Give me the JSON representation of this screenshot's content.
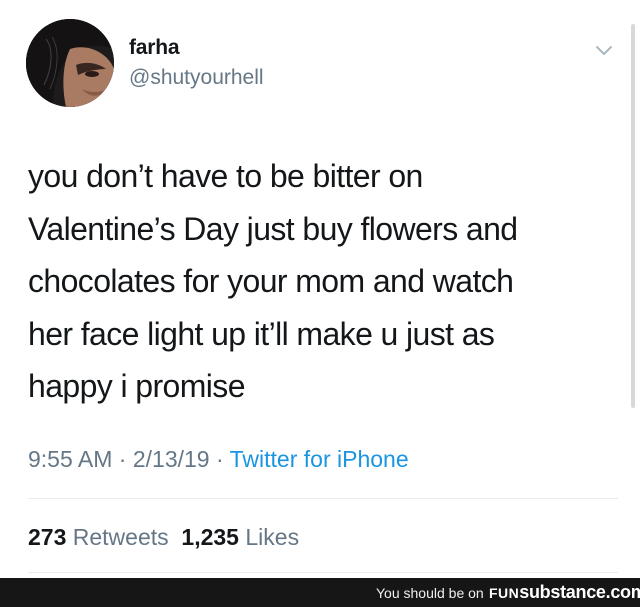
{
  "user": {
    "display_name": "farha",
    "handle": "@shutyourhell"
  },
  "tweet": {
    "lines": [
      "you don’t have to be bitter on",
      "Valentine’s Day just buy flowers and",
      "chocolates for your mom and watch",
      "her face light up it’ll make u just as",
      "happy i promise"
    ],
    "time": "9:55 AM",
    "separator": "·",
    "date": "2/13/19",
    "source": "Twitter for iPhone"
  },
  "stats": {
    "retweets_count": "273",
    "retweets_label": "Retweets",
    "likes_count": "1,235",
    "likes_label": "Likes"
  },
  "footer": {
    "tagline": "You should be on",
    "logo_fun": "FUN",
    "logo_rest": "substance.com"
  },
  "icons": {
    "menu": "chevron-down-icon",
    "avatar": "profile-photo"
  },
  "colors": {
    "text": "#14171a",
    "muted": "#657786",
    "link": "#1b95e0",
    "footer_bg": "#161616"
  }
}
